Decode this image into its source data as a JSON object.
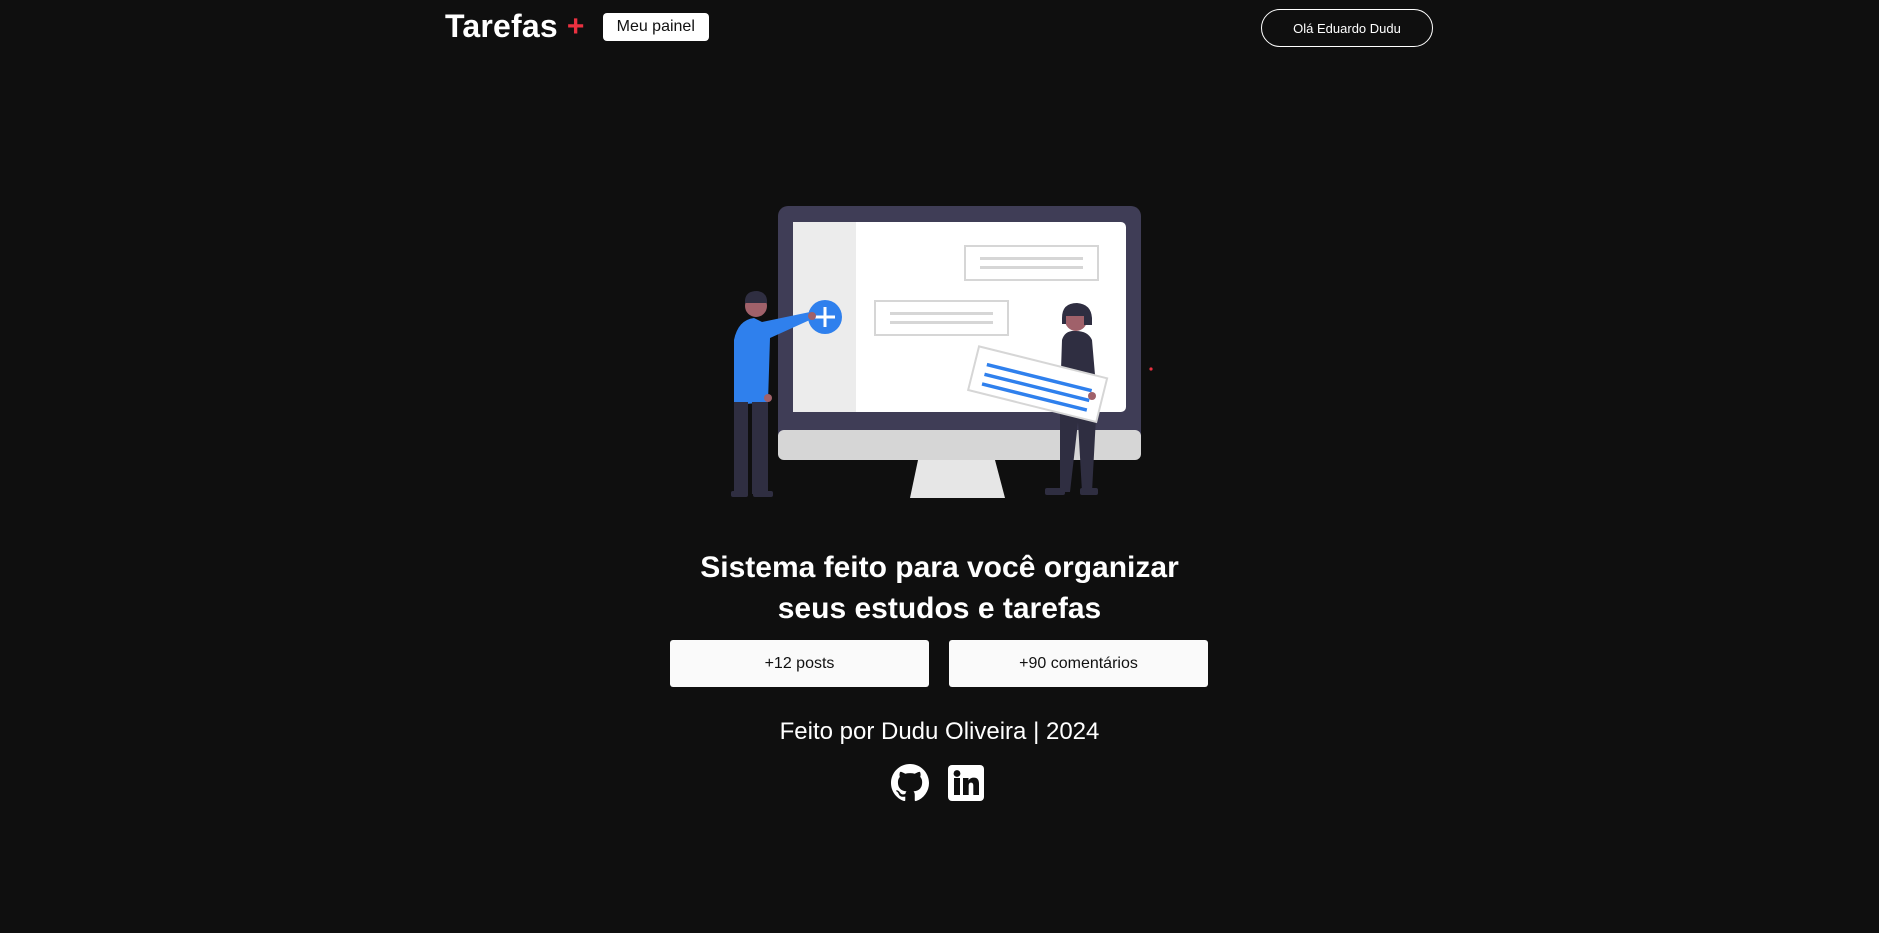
{
  "header": {
    "brand_title": "Tarefas",
    "brand_plus": "+",
    "panel_button_label": "Meu painel",
    "user_button_label": "Olá Eduardo Dudu"
  },
  "main": {
    "headline_line1": "Sistema feito para você organizar",
    "headline_line2": "seus estudos e tarefas",
    "stats": [
      {
        "label": "+12 posts"
      },
      {
        "label": "+90 comentários"
      }
    ],
    "footer_text": "Feito por Dudu Oliveira | 2024",
    "social_icons": [
      "github-icon",
      "linkedin-icon"
    ]
  },
  "colors": {
    "background": "#0f0f0f",
    "accent": "#ea3140",
    "illustration_blue": "#2f80ed",
    "monitor_frame": "#3f3d56"
  }
}
